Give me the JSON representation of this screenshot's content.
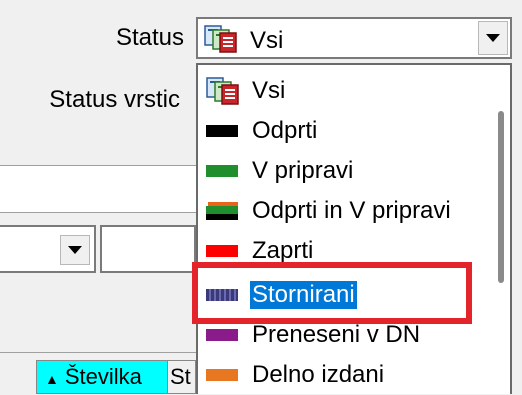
{
  "labels": {
    "status": "Status",
    "status_rows": "Status vrstic"
  },
  "status_combo": {
    "value": "Vsi",
    "icon": "multi-document-icon"
  },
  "dropdown": {
    "items": [
      {
        "label": "Vsi",
        "icon": "multi-document-icon"
      },
      {
        "label": "Odprti",
        "color": "#000000"
      },
      {
        "label": "V pripravi",
        "color": "#1f8f2e"
      },
      {
        "label": "Odprti in V pripravi",
        "color": "#1f8f2e",
        "color2": "#e8641c",
        "color3": "#000000"
      },
      {
        "label": "Zaprti",
        "color": "#ff0000"
      },
      {
        "label": "Stornirani",
        "color": "#3a3a7a",
        "selected": true
      },
      {
        "label": "Preneseni v DN",
        "color": "#8b1a8b"
      },
      {
        "label": "Delno izdani",
        "color": "#e87722"
      }
    ]
  },
  "table_header": {
    "sort_column": "Številka",
    "next_column": "St"
  },
  "colors": {
    "highlight_box": "#e3242b",
    "selection": "#0078d7",
    "sorted_column_bg": "#00ffff"
  }
}
